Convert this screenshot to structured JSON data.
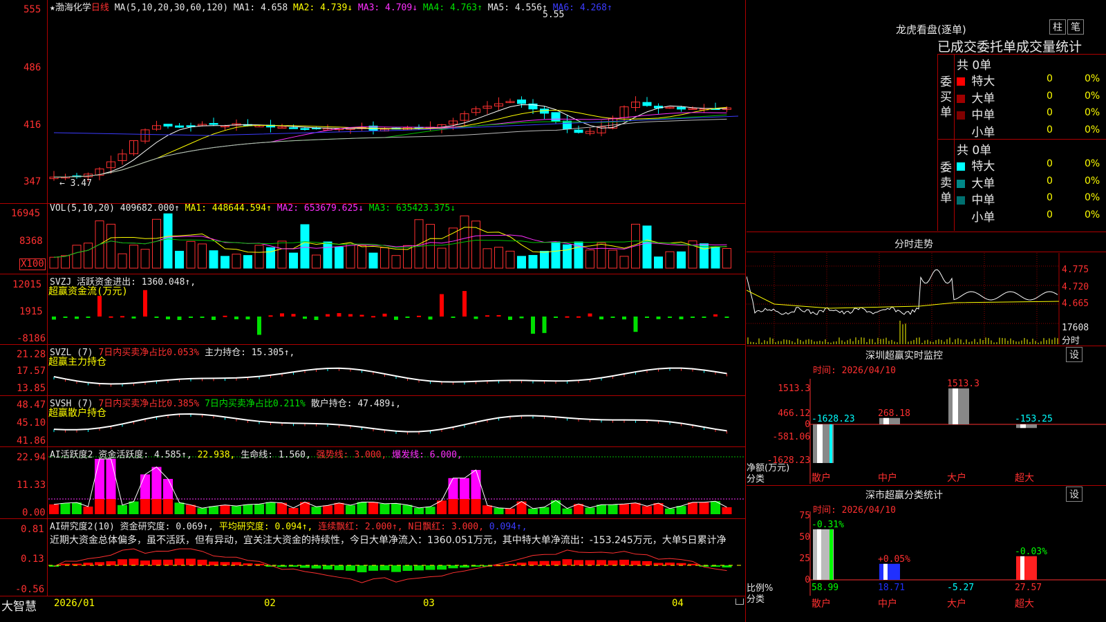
{
  "stock": {
    "name": "渤海化学",
    "star": "★",
    "period": "日线"
  },
  "main_chart": {
    "ma_label": "MA(5,10,20,30,60,120)",
    "ma1": "MA1: 4.658",
    "ma2": "MA2: 4.739↓",
    "ma3": "MA3: 4.709↓",
    "ma4": "MA4: 4.763↑",
    "ma5": "MA5: 4.556↑",
    "ma6": "MA6: 4.268↑",
    "high_label": "5.55",
    "low_label": "3.47",
    "y_ticks": [
      "555",
      "486",
      "416",
      "347"
    ]
  },
  "vol": {
    "label": "VOL(5,10,20)",
    "value": "409682.000↑",
    "ma1": "MA1: 448644.594↑",
    "ma2": "MA2: 653679.625↓",
    "ma3": "MA3: 635423.375↓",
    "y_ticks": [
      "16945",
      "8368"
    ],
    "unit": "X100"
  },
  "svzj": {
    "label": "SVZJ",
    "text": "活跃资金进出: 1360.048↑,",
    "title": "超赢资金流(万元)",
    "y_ticks": [
      "12015",
      "1915",
      "-8186"
    ]
  },
  "svzl": {
    "label": "SVZL (7)",
    "net": "7日内买卖净占比0.053%",
    "hold": "主力持仓: 15.305↑,",
    "title": "超赢主力持仓",
    "y_ticks": [
      "21.28",
      "17.57",
      "13.85"
    ]
  },
  "svsh": {
    "label": "SVSH (7)",
    "net1": "7日内买卖净占比0.385%",
    "net2": "7日内买卖净占比0.211%",
    "hold": "散户持仓: 47.489↓,",
    "title": "超赢散户持仓",
    "y_ticks": [
      "48.47",
      "45.10",
      "41.86"
    ]
  },
  "ai_active": {
    "label": "AI活跃度2",
    "a": "资金活跃度: 4.585↑,",
    "b": "22.938,",
    "c": "生命线: 1.560,",
    "d": "强势线: 3.000,",
    "e": "爆发线: 6.000,",
    "y_ticks": [
      "22.94",
      "11.33",
      "0.00"
    ]
  },
  "ai_research": {
    "label": "AI研究度2(10)",
    "a": "资金研究度: 0.069↑,",
    "b": "平均研究度: 0.094↑,",
    "c": "连续飘红: 2.000↑,",
    "d": "N日飘红: 3.000,",
    "e": "0.094↑,",
    "commentary": "近期大资金总体偏多，虽不活跃，但有异动，宜关注大资金的持续性，今日大单净流入：1360.051万元，其中特大单净流出：-153.245万元，大单5日累计净",
    "y_ticks": [
      "0.81",
      "0.13",
      "-0.56"
    ]
  },
  "x_axis": [
    "2026/01",
    "02",
    "03",
    "04"
  ],
  "brand": "大智慧",
  "dragon": {
    "title": "龙虎看盘(逐单)",
    "btn1": "柱",
    "btn2": "笔",
    "subtitle": "已成交委托单成交量统计",
    "buy": {
      "side": "委买单",
      "total": "共 0单",
      "rows": [
        {
          "name": "特大",
          "v": "0",
          "p": "0%",
          "c": "#ff0000"
        },
        {
          "name": "大单",
          "v": "0",
          "p": "0%",
          "c": "#a00000"
        },
        {
          "name": "中单",
          "v": "0",
          "p": "0%",
          "c": "#800000"
        },
        {
          "name": "小单",
          "v": "0",
          "p": "0%",
          "c": ""
        }
      ]
    },
    "sell": {
      "side": "委卖单",
      "total": "共 0单",
      "rows": [
        {
          "name": "特大",
          "v": "0",
          "p": "0%",
          "c": "#00ffff"
        },
        {
          "name": "大单",
          "v": "0",
          "p": "0%",
          "c": "#008888"
        },
        {
          "name": "中单",
          "v": "0",
          "p": "0%",
          "c": "#007070"
        },
        {
          "name": "小单",
          "v": "0",
          "p": "0%",
          "c": ""
        }
      ]
    }
  },
  "intraday": {
    "title": "分时走势",
    "prices": [
      "4.775",
      "4.720",
      "4.665"
    ],
    "vol_label": "17608",
    "unit": "分时"
  },
  "sz_monitor": {
    "title": "深圳超赢实时监控",
    "btn": "设",
    "time": "时间: 2026/04/10",
    "y_ticks": [
      "1513.3",
      "466.12",
      "0",
      "-581.06",
      "-1628.23"
    ],
    "bars": [
      {
        "label": "-1628.23",
        "value": -1628.23
      },
      {
        "label": "268.18",
        "value": 268.18
      },
      {
        "label": "1513.3",
        "value": 1513.3
      },
      {
        "label": "-153.25",
        "value": -153.25
      }
    ],
    "axis_title": "净额(万元)",
    "axis_sub": "分类",
    "categories": [
      "散户",
      "中户",
      "大户",
      "超大"
    ]
  },
  "sz_class": {
    "title": "深市超赢分类统计",
    "btn": "设",
    "time": "时间: 2026/04/10",
    "y_ticks": [
      "75",
      "50",
      "25",
      "0"
    ],
    "bars": [
      {
        "top": "-0.31%",
        "value": 58.99,
        "bottom": "58.99"
      },
      {
        "top": "+0.05%",
        "value": 18.71,
        "bottom": "18.71"
      },
      {
        "top": "",
        "value": 0,
        "bottom": "-5.27"
      },
      {
        "top": "-0.03%",
        "value": 27.57,
        "bottom": "27.57"
      }
    ],
    "axis_title": "比例%",
    "axis_sub": "分类",
    "categories": [
      "散户",
      "中户",
      "大户",
      "超大"
    ]
  }
}
